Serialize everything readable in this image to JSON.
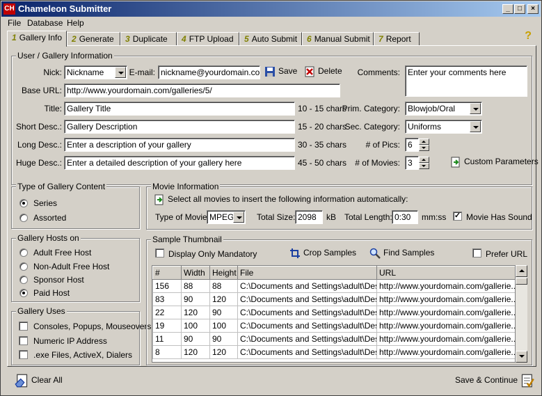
{
  "window": {
    "title": "Chameleon Submitter",
    "icon_text": "CH"
  },
  "menu": [
    "File",
    "Database",
    "Help"
  ],
  "tabs": [
    {
      "num": "1",
      "label": "Gallery Info"
    },
    {
      "num": "2",
      "label": "Generate"
    },
    {
      "num": "3",
      "label": "Duplicate"
    },
    {
      "num": "4",
      "label": "FTP Upload"
    },
    {
      "num": "5",
      "label": "Auto Submit"
    },
    {
      "num": "6",
      "label": "Manual Submit"
    },
    {
      "num": "7",
      "label": "Report"
    }
  ],
  "user_info": {
    "legend": "User / Gallery Information",
    "nick_label": "Nick:",
    "nick_value": "Nickname",
    "email_label": "E-mail:",
    "email_value": "nickname@yourdomain.com",
    "save_label": "Save",
    "delete_label": "Delete",
    "comments_label": "Comments:",
    "comments_value": "Enter your comments here",
    "base_url_label": "Base URL:",
    "base_url_value": "http://www.yourdomain.com/galleries/5/",
    "title_label": "Title:",
    "title_value": "Gallery Title",
    "title_hint": "10 - 15 chars",
    "short_label": "Short Desc.:",
    "short_value": "Gallery Description",
    "short_hint": "15 - 20 chars",
    "long_label": "Long Desc.:",
    "long_value": "Enter a description of your gallery",
    "long_hint": "30 - 35 chars",
    "huge_label": "Huge Desc.:",
    "huge_value": "Enter a detailed description of your gallery here",
    "huge_hint": "45 - 50 chars",
    "prim_cat_label": "Prim. Category:",
    "prim_cat_value": "Blowjob/Oral",
    "sec_cat_label": "Sec. Category:",
    "sec_cat_value": "Uniforms",
    "pics_label": "# of Pics:",
    "pics_value": "6",
    "movies_label": "# of Movies:",
    "movies_value": "3",
    "custom_params_label": "Custom Parameters"
  },
  "content_type": {
    "legend": "Type of Gallery Content",
    "options": [
      {
        "label": "Series",
        "selected": true
      },
      {
        "label": "Assorted",
        "selected": false
      }
    ]
  },
  "hosts": {
    "legend": "Gallery Hosts on",
    "options": [
      {
        "label": "Adult Free Host",
        "selected": false
      },
      {
        "label": "Non-Adult Free Host",
        "selected": false
      },
      {
        "label": "Sponsor Host",
        "selected": false
      },
      {
        "label": "Paid Host",
        "selected": true
      }
    ]
  },
  "uses": {
    "legend": "Gallery Uses",
    "options": [
      {
        "label": "Consoles, Popups, Mouseovers",
        "checked": false
      },
      {
        "label": "Numeric IP Address",
        "checked": false
      },
      {
        "label": ".exe Files, ActiveX, Dialers",
        "checked": false
      }
    ]
  },
  "movie": {
    "legend": "Movie Information",
    "select_all_label": "Select all movies to insert the following information automatically:",
    "type_label": "Type of Movie:",
    "type_value": "MPEG",
    "size_label": "Total Size:",
    "size_value": "2098",
    "size_unit": "kB",
    "length_label": "Total Length:",
    "length_value": "0:30",
    "length_unit": "mm:ss",
    "sound_label": "Movie Has Sound",
    "sound_checked": true
  },
  "thumbs": {
    "legend": "Sample Thumbnail",
    "mandatory_label": "Display Only Mandatory",
    "mandatory_checked": false,
    "crop_label": "Crop Samples",
    "find_label": "Find Samples",
    "prefer_url_label": "Prefer URL",
    "prefer_url_checked": false,
    "columns": [
      "#",
      "Width",
      "Height",
      "File",
      "URL"
    ],
    "rows": [
      [
        "156",
        "88",
        "88",
        "C:\\Documents and Settings\\adult\\Des...",
        "http://www.yourdomain.com/gallerie..."
      ],
      [
        "83",
        "90",
        "120",
        "C:\\Documents and Settings\\adult\\Des...",
        "http://www.yourdomain.com/gallerie..."
      ],
      [
        "22",
        "120",
        "90",
        "C:\\Documents and Settings\\adult\\Des...",
        "http://www.yourdomain.com/gallerie..."
      ],
      [
        "19",
        "100",
        "100",
        "C:\\Documents and Settings\\adult\\Des...",
        "http://www.yourdomain.com/gallerie..."
      ],
      [
        "11",
        "90",
        "90",
        "C:\\Documents and Settings\\adult\\Des...",
        "http://www.yourdomain.com/gallerie..."
      ],
      [
        "8",
        "120",
        "120",
        "C:\\Documents and Settings\\adult\\Des...",
        "http://www.yourdomain.com/gallerie..."
      ]
    ]
  },
  "footer": {
    "clear_all_label": "Clear All",
    "save_continue_label": "Save & Continue"
  }
}
